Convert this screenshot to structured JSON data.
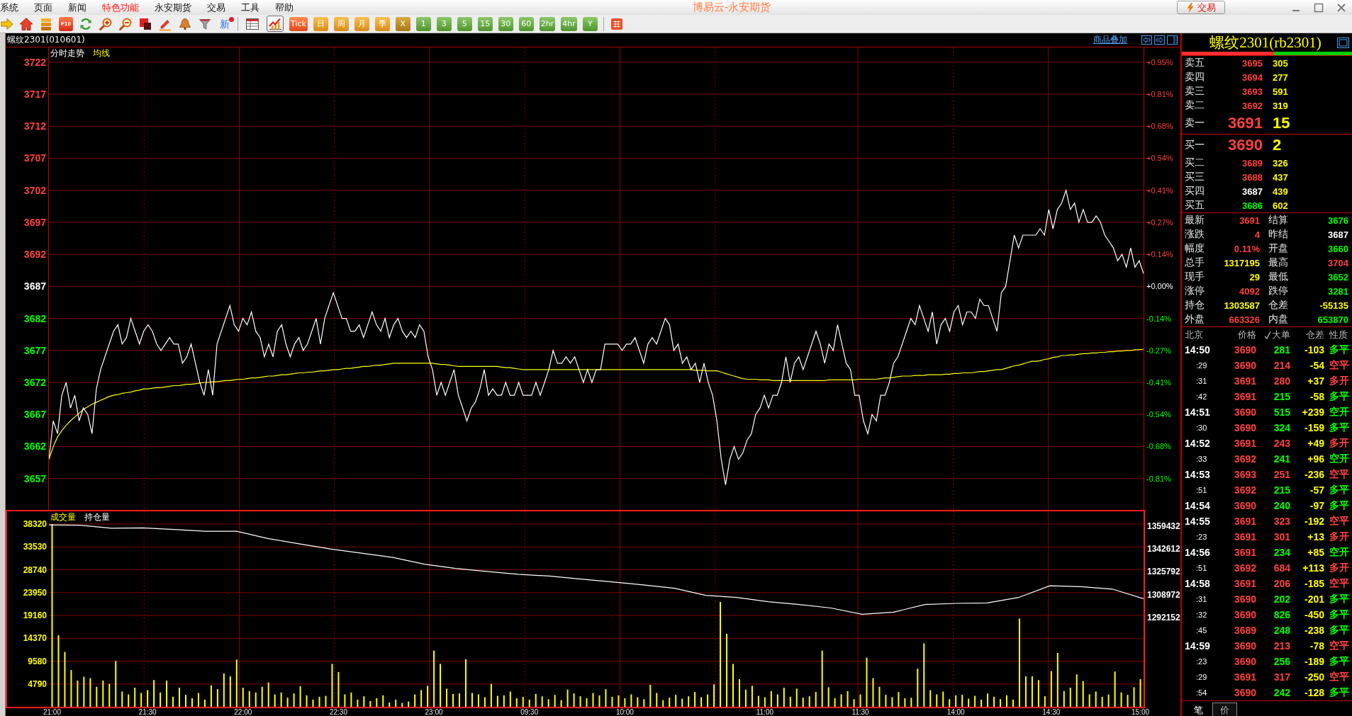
{
  "menu_bar": {
    "items": [
      {
        "label": "系统",
        "highlighted": false
      },
      {
        "label": "页面",
        "highlighted": false
      },
      {
        "label": "新闻",
        "highlighted": false
      },
      {
        "label": "特色功能",
        "highlighted": true
      },
      {
        "label": "永安期货",
        "highlighted": false
      },
      {
        "label": "交易",
        "highlighted": false
      },
      {
        "label": "工具",
        "highlighted": false
      },
      {
        "label": "帮助",
        "highlighted": false
      }
    ],
    "title": "博易云-永安期货",
    "trade_button": "交易"
  },
  "toolbar": {
    "f10_label": "F10",
    "news_label": "新",
    "news_unread": true,
    "view_buttons": [
      {
        "selected": false
      },
      {
        "selected": true
      }
    ],
    "periods": [
      {
        "label": "Tick",
        "kind": "tick"
      },
      {
        "label": "日",
        "kind": "orange"
      },
      {
        "label": "周",
        "kind": "orange"
      },
      {
        "label": "月",
        "kind": "orange"
      },
      {
        "label": "季",
        "kind": "orange"
      },
      {
        "label": "X",
        "kind": "gold"
      },
      {
        "label": "1",
        "kind": "green"
      },
      {
        "label": "3",
        "kind": "green"
      },
      {
        "label": "5",
        "kind": "green"
      },
      {
        "label": "15",
        "kind": "green"
      },
      {
        "label": "30",
        "kind": "green"
      },
      {
        "label": "60",
        "kind": "green"
      },
      {
        "label": "2hr",
        "kind": "green"
      },
      {
        "label": "4hr",
        "kind": "green"
      },
      {
        "label": "Y",
        "kind": "green"
      }
    ]
  },
  "chart_header": {
    "symbol": "螺纹2301(010601)",
    "overlay_link": "商品叠加"
  },
  "price_panel": {
    "percent_axis": [
      {
        "label": "+0.95%",
        "kind": "up"
      },
      {
        "label": "+0.81%",
        "kind": "up"
      },
      {
        "label": "+0.68%",
        "kind": "up"
      },
      {
        "label": "+0.54%",
        "kind": "up"
      },
      {
        "label": "+0.41%",
        "kind": "up"
      },
      {
        "label": "+0.27%",
        "kind": "up"
      },
      {
        "label": "+0.14%",
        "kind": "up"
      },
      {
        "label": "+0.00%",
        "kind": "flat"
      },
      {
        "label": "-0.14%",
        "kind": "down"
      },
      {
        "label": "-0.27%",
        "kind": "down"
      },
      {
        "label": "-0.41%",
        "kind": "down"
      },
      {
        "label": "-0.54%",
        "kind": "down"
      },
      {
        "label": "-0.68%",
        "kind": "down"
      },
      {
        "label": "-0.81%",
        "kind": "down"
      }
    ],
    "chart_data": {
      "type": "line",
      "grid": true,
      "ylim": [
        3652.1,
        3724.3
      ],
      "yticks": [
        3722,
        3717,
        3712,
        3707,
        3702,
        3697,
        3692,
        3687,
        3682,
        3677,
        3672,
        3667,
        3662,
        3657
      ],
      "series": [
        {
          "name": "分时走势",
          "color": "#ffffff",
          "values": [
            3660,
            3666,
            3664,
            3670,
            3672,
            3668,
            3670,
            3666,
            3668,
            3667,
            3664,
            3671,
            3674,
            3676,
            3678,
            3680,
            3681,
            3678,
            3679,
            3682,
            3680,
            3678,
            3680,
            3681,
            3680,
            3678,
            3677,
            3678,
            3679,
            3678,
            3678,
            3675,
            3676,
            3678,
            3675,
            3672,
            3670,
            3674,
            3670,
            3678,
            3680,
            3682,
            3684,
            3681,
            3680,
            3682,
            3681,
            3683,
            3680,
            3679,
            3676,
            3678,
            3676,
            3680,
            3681,
            3678,
            3676,
            3678,
            3679,
            3677,
            3678,
            3680,
            3682,
            3678,
            3682,
            3684,
            3686,
            3684,
            3682,
            3682,
            3680,
            3680,
            3681,
            3679,
            3681,
            3683,
            3681,
            3680,
            3682,
            3679,
            3681,
            3682,
            3680,
            3679,
            3680,
            3679,
            3681,
            3680,
            3676,
            3674,
            3670,
            3672,
            3670,
            3672,
            3674,
            3670,
            3668,
            3666,
            3668,
            3669,
            3671,
            3674,
            3670,
            3671,
            3670,
            3670,
            3672,
            3670,
            3670,
            3672,
            3670,
            3670,
            3670,
            3672,
            3670,
            3672,
            3674,
            3677,
            3675,
            3675,
            3676,
            3675,
            3676,
            3674,
            3672,
            3674,
            3672,
            3674,
            3674,
            3678,
            3678,
            3678,
            3678,
            3677,
            3678,
            3678,
            3679,
            3677,
            3675,
            3678,
            3679,
            3678,
            3680,
            3682,
            3681,
            3677,
            3678,
            3675,
            3676,
            3674,
            3675,
            3672,
            3675,
            3672,
            3670,
            3666,
            3660,
            3656,
            3660,
            3662,
            3660,
            3661,
            3663,
            3664,
            3667,
            3668,
            3670,
            3668,
            3670,
            3670,
            3672,
            3676,
            3672,
            3675,
            3676,
            3674,
            3676,
            3678,
            3680,
            3678,
            3675,
            3678,
            3677,
            3681,
            3678,
            3675,
            3674,
            3670,
            3670,
            3666,
            3664,
            3667,
            3666,
            3670,
            3670,
            3672,
            3675,
            3676,
            3678,
            3680,
            3682,
            3681,
            3684,
            3682,
            3680,
            3683,
            3678,
            3681,
            3682,
            3680,
            3683,
            3684,
            3681,
            3683,
            3683,
            3682,
            3685,
            3684,
            3684,
            3682,
            3680,
            3686,
            3687,
            3691,
            3695,
            3693,
            3695,
            3695,
            3695,
            3695,
            3696,
            3695,
            3699,
            3696,
            3699,
            3700,
            3702,
            3699,
            3700,
            3697,
            3699,
            3697,
            3697,
            3698,
            3697,
            3695,
            3694,
            3693,
            3691,
            3692,
            3690,
            3693,
            3690,
            3691,
            3689
          ]
        },
        {
          "name": "均线",
          "color": "#ffff00",
          "values": [
            3660,
            3662,
            3663.5,
            3664.5,
            3665.3,
            3666,
            3666.6,
            3667.2,
            3667.8,
            3668.2,
            3668.6,
            3668.9,
            3669.2,
            3669.5,
            3669.8,
            3670,
            3670.1,
            3670.3,
            3670.4,
            3670.5,
            3670.7,
            3670.8,
            3671,
            3671,
            3671.1,
            3671.2,
            3671.2,
            3671.3,
            3671.4,
            3671.5,
            3671.5,
            3671.6,
            3671.7,
            3671.7,
            3671.8,
            3671.9,
            3672,
            3672,
            3672.1,
            3672.1,
            3672.2,
            3672.3,
            3672.3,
            3672.4,
            3672.5,
            3672.5,
            3672.6,
            3672.7,
            3672.7,
            3672.8,
            3672.9,
            3673,
            3673,
            3673.1,
            3673.2,
            3673.2,
            3673.3,
            3673.4,
            3673.5,
            3673.5,
            3673.6,
            3673.6,
            3673.7,
            3673.8,
            3673.8,
            3673.9,
            3674,
            3674,
            3674.1,
            3674.2,
            3674.2,
            3674.3,
            3674.4,
            3674.5,
            3674.5,
            3674.6,
            3674.7,
            3674.7,
            3674.8,
            3674.9,
            3675,
            3675,
            3675,
            3675,
            3675,
            3675,
            3675,
            3675,
            3675,
            3675,
            3674.9,
            3674.8,
            3674.8,
            3674.7,
            3674.6,
            3674.5,
            3674.5,
            3674.5,
            3674.5,
            3674.5,
            3674.5,
            3674.5,
            3674.5,
            3674.5,
            3674.5,
            3674.4,
            3674.3,
            3674.3,
            3674.2,
            3674.1,
            3674,
            3674,
            3674,
            3674,
            3674,
            3674,
            3674,
            3674,
            3674,
            3674,
            3674,
            3674,
            3674,
            3674,
            3674,
            3674,
            3674,
            3674,
            3674,
            3674,
            3674,
            3674,
            3674,
            3674,
            3674,
            3674,
            3674,
            3674,
            3674,
            3674,
            3674,
            3674,
            3674,
            3674,
            3674,
            3674,
            3674,
            3674,
            3674,
            3674,
            3673.9,
            3673.9,
            3673.9,
            3673.8,
            3673.8,
            3673.8,
            3673.6,
            3673.4,
            3673.2,
            3673,
            3672.8,
            3672.6,
            3672.5,
            3672.5,
            3672.5,
            3672.4,
            3672.4,
            3672.4,
            3672.3,
            3672.3,
            3672.3,
            3672.3,
            3672.3,
            3672.3,
            3672.3,
            3672.3,
            3672.3,
            3672.3,
            3672.3,
            3672.3,
            3672.3,
            3672.4,
            3672.4,
            3672.4,
            3672.4,
            3672.4,
            3672.4,
            3672.4,
            3672.5,
            3672.5,
            3672.5,
            3672.5,
            3672.5,
            3672.6,
            3672.7,
            3672.7,
            3672.8,
            3672.9,
            3673,
            3673,
            3673,
            3673.1,
            3673.1,
            3673.1,
            3673.2,
            3673.2,
            3673.2,
            3673.2,
            3673.3,
            3673.3,
            3673.4,
            3673.4,
            3673.5,
            3673.5,
            3673.5,
            3673.6,
            3673.7,
            3673.7,
            3673.8,
            3673.9,
            3674,
            3674,
            3674.2,
            3674.4,
            3674.6,
            3674.7,
            3674.9,
            3675.1,
            3675.3,
            3675.3,
            3675.4,
            3675.6,
            3675.7,
            3675.9,
            3676,
            3676.2,
            3676.2,
            3676.3,
            3676.3,
            3676.4,
            3676.5,
            3676.5,
            3676.6,
            3676.6,
            3676.7,
            3676.7,
            3676.8,
            3676.8,
            3676.9,
            3676.9,
            3677,
            3677,
            3677.1,
            3677.1,
            3677.2
          ]
        }
      ]
    }
  },
  "volume_panel": {
    "chart_data": {
      "type": "bar",
      "grid": true,
      "ylim": [
        0,
        41000
      ],
      "yticks": [
        38320,
        33530,
        28740,
        23950,
        19160,
        14370,
        9580,
        4790
      ],
      "categories": [
        "21:00",
        null,
        null,
        null,
        null,
        null,
        null,
        null,
        null,
        null,
        null,
        null,
        null,
        null,
        null,
        "21:30",
        null,
        null,
        null,
        null,
        null,
        null,
        null,
        null,
        null,
        null,
        null,
        null,
        null,
        null,
        "22:00",
        null,
        null,
        null,
        null,
        null,
        null,
        null,
        null,
        null,
        null,
        null,
        null,
        null,
        null,
        "22:30",
        null,
        null,
        null,
        null,
        null,
        null,
        null,
        null,
        null,
        null,
        null,
        null,
        null,
        null,
        "23:00",
        null,
        null,
        null,
        null,
        null,
        null,
        null,
        null,
        null,
        null,
        null,
        null,
        null,
        null,
        "09:30",
        null,
        null,
        null,
        null,
        null,
        null,
        null,
        null,
        null,
        null,
        null,
        null,
        null,
        null,
        "10:00",
        null,
        null,
        null,
        null,
        null,
        null,
        null,
        null,
        null,
        null,
        null,
        null,
        null,
        null,
        null,
        null,
        null,
        null,
        null,
        null,
        null,
        "11:00",
        null,
        null,
        null,
        null,
        null,
        null,
        null,
        null,
        null,
        null,
        null,
        null,
        null,
        null,
        "11:30",
        null,
        null,
        null,
        null,
        null,
        null,
        null,
        null,
        null,
        null,
        null,
        null,
        null,
        null,
        "14:00",
        null,
        null,
        null,
        null,
        null,
        null,
        null,
        null,
        null,
        null,
        null,
        null,
        null,
        null,
        "14:30",
        null,
        null,
        null,
        null,
        null,
        null,
        null,
        null,
        null,
        null,
        null,
        null,
        null,
        "15:00"
      ],
      "series": [
        {
          "name": "成交量",
          "color": "#ffff00",
          "values": [
            38300,
            15000,
            11500,
            7700,
            5500,
            6300,
            6000,
            4200,
            5500,
            4800,
            9600,
            3200,
            2600,
            4000,
            2900,
            3500,
            5600,
            3000,
            5500,
            2100,
            4000,
            2500,
            1800,
            2900,
            1500,
            4500,
            3700,
            7000,
            6400,
            9900,
            4000,
            3300,
            3000,
            4200,
            5100,
            2600,
            3000,
            1900,
            2800,
            4300,
            2400,
            1500,
            2100,
            2300,
            9000,
            7300,
            2600,
            3000,
            1500,
            2200,
            1200,
            1800,
            2400,
            900,
            1500,
            800,
            1100,
            2600,
            3500,
            4400,
            11800,
            9000,
            3800,
            2700,
            2800,
            10000,
            2900,
            2600,
            2000,
            4800,
            2300,
            2400,
            3200,
            1800,
            2100,
            1500,
            2700,
            2200,
            1600,
            2500,
            1400,
            3600,
            2800,
            2200,
            1800,
            2900,
            2400,
            3700,
            2100,
            2400,
            1800,
            2600,
            2000,
            1600,
            4600,
            2900,
            1400,
            1900,
            2500,
            1700,
            2200,
            3100,
            2000,
            2600,
            4700,
            22000,
            15300,
            9000,
            5800,
            3600,
            4400,
            2300,
            2000,
            3300,
            2600,
            4000,
            2100,
            3800,
            1900,
            2200,
            3100,
            11800,
            4100,
            1800,
            2600,
            3300,
            1600,
            2600,
            10300,
            6000,
            4200,
            2500,
            2000,
            3100,
            1800,
            1900,
            8000,
            13300,
            3500,
            2600,
            3200,
            1600,
            2400,
            2500,
            1700,
            2300,
            1500,
            2800,
            2100,
            1600,
            2400,
            1500,
            18500,
            6400,
            6400,
            5600,
            2200,
            7500,
            11300,
            3300,
            4000,
            6800,
            5400,
            2600,
            3200,
            2100,
            2600,
            7400,
            3000,
            2500,
            4100,
            5800
          ]
        }
      ]
    },
    "open_interest": {
      "chart_data": {
        "type": "line",
        "ylim": [
          1224872,
          1368750
        ],
        "yticks": [
          1359432,
          1342612,
          1325792,
          1308972,
          1292152
        ],
        "series": [
          {
            "name": "持仓量",
            "color": "#ffffff",
            "values": [
              1358800,
              1358500,
              1356300,
              1356600,
              1355400,
              1354100,
              1354100,
              1348800,
              1344800,
              1341000,
              1337900,
              1334800,
              1329800,
              1326700,
              1324500,
              1322400,
              1321100,
              1318900,
              1316800,
              1314600,
              1312100,
              1306900,
              1305300,
              1302200,
              1300100,
              1297600,
              1293000,
              1294500,
              1300100,
              1301000,
              1301300,
              1305300,
              1313900,
              1313300,
              1311500,
              1304400
            ]
          }
        ]
      }
    }
  },
  "quote_panel": {
    "title": "螺纹2301(rb2301)",
    "ratio_bar": {
      "level": 0.54
    },
    "asks": [
      {
        "label": "卖五",
        "price": "3695",
        "volume": "305",
        "color": "#ff4040",
        "kind": "level"
      },
      {
        "label": "卖四",
        "price": "3694",
        "volume": "277",
        "color": "#ff4040",
        "kind": "level"
      },
      {
        "label": "卖三",
        "price": "3693",
        "volume": "591",
        "color": "#ff4040",
        "kind": "level"
      },
      {
        "label": "卖二",
        "price": "3692",
        "volume": "319",
        "color": "#ff4040",
        "kind": "level"
      },
      {
        "label": "卖一",
        "price": "3691",
        "volume": "15",
        "color": "#ff4040",
        "kind": "best"
      }
    ],
    "bids": [
      {
        "label": "买一",
        "price": "3690",
        "volume": "2",
        "color": "#ff4040",
        "kind": "best"
      },
      {
        "label": "买二",
        "price": "3689",
        "volume": "326",
        "color": "#ff4040",
        "kind": "level"
      },
      {
        "label": "买三",
        "price": "3688",
        "volume": "437",
        "color": "#ff4040",
        "kind": "level"
      },
      {
        "label": "买四",
        "price": "3687",
        "volume": "439",
        "color": "#ffffff",
        "kind": "level"
      },
      {
        "label": "买五",
        "price": "3686",
        "volume": "602",
        "color": "#00ff00",
        "kind": "level"
      }
    ],
    "stats": [
      {
        "label": "最新",
        "value": "3691",
        "color": "#ff4040"
      },
      {
        "label": "结算",
        "value": "3676",
        "color": "#00ff00"
      },
      {
        "label": "涨跌",
        "value": "4",
        "color": "#ff4040"
      },
      {
        "label": "昨结",
        "value": "3687",
        "color": "#ffffff"
      },
      {
        "label": "幅度",
        "value": "0.11%",
        "color": "#ff4040"
      },
      {
        "label": "开盘",
        "value": "3660",
        "color": "#00ff00"
      },
      {
        "label": "总手",
        "value": "1317195",
        "color": "#ffff00"
      },
      {
        "label": "最高",
        "value": "3704",
        "color": "#ff4040"
      },
      {
        "label": "现手",
        "value": "29",
        "color": "#ffff00"
      },
      {
        "label": "最低",
        "value": "3652",
        "color": "#00ff00"
      },
      {
        "label": "涨停",
        "value": "4092",
        "color": "#ff4040"
      },
      {
        "label": "跌停",
        "value": "3281",
        "color": "#00ff00"
      },
      {
        "label": "持仓",
        "value": "1303587",
        "color": "#ffff00"
      },
      {
        "label": "仓差",
        "value": "-55135",
        "color": "#ffff00"
      },
      {
        "label": "外盘",
        "value": "663326",
        "color": "#ff4040"
      },
      {
        "label": "内盘",
        "value": "653870",
        "color": "#00ff00"
      }
    ],
    "trade_columns": [
      {
        "label": "北京",
        "kind": "text"
      },
      {
        "label": "价格",
        "kind": "text"
      },
      {
        "label": "大单",
        "kind": "toggle",
        "checked": true
      },
      {
        "label": "仓差",
        "kind": "text"
      },
      {
        "label": "性质",
        "kind": "text"
      }
    ],
    "trades": [
      {
        "time": "14:50",
        "kind": "minute",
        "price": "3690",
        "volume": {
          "value": "281",
          "color": "#00ff00"
        },
        "oi_change": "-103",
        "nature": {
          "label": "多平",
          "color": "#00ff00"
        }
      },
      {
        "time": ":29",
        "kind": "second",
        "price": "3690",
        "volume": {
          "value": "214",
          "color": "#ff4040"
        },
        "oi_change": "-54",
        "nature": {
          "label": "空平",
          "color": "#ff4040"
        }
      },
      {
        "time": ":31",
        "kind": "second",
        "price": "3691",
        "volume": {
          "value": "280",
          "color": "#ff4040"
        },
        "oi_change": "+37",
        "nature": {
          "label": "多开",
          "color": "#ff4040"
        }
      },
      {
        "time": ":42",
        "kind": "second",
        "price": "3691",
        "volume": {
          "value": "215",
          "color": "#00ff00"
        },
        "oi_change": "-58",
        "nature": {
          "label": "多平",
          "color": "#00ff00"
        }
      },
      {
        "time": "14:51",
        "kind": "minute",
        "price": "3690",
        "volume": {
          "value": "515",
          "color": "#00ff00"
        },
        "oi_change": "+239",
        "nature": {
          "label": "空开",
          "color": "#00ff00"
        }
      },
      {
        "time": ":30",
        "kind": "second",
        "price": "3690",
        "volume": {
          "value": "324",
          "color": "#00ff00"
        },
        "oi_change": "-159",
        "nature": {
          "label": "多平",
          "color": "#00ff00"
        }
      },
      {
        "time": "14:52",
        "kind": "minute",
        "price": "3691",
        "volume": {
          "value": "243",
          "color": "#ff4040"
        },
        "oi_change": "+49",
        "nature": {
          "label": "多开",
          "color": "#ff4040"
        }
      },
      {
        "time": ":33",
        "kind": "second",
        "price": "3692",
        "volume": {
          "value": "241",
          "color": "#00ff00"
        },
        "oi_change": "+96",
        "nature": {
          "label": "空开",
          "color": "#00ff00"
        }
      },
      {
        "time": "14:53",
        "kind": "minute",
        "price": "3693",
        "volume": {
          "value": "251",
          "color": "#ff4040"
        },
        "oi_change": "-236",
        "nature": {
          "label": "空平",
          "color": "#ff4040"
        }
      },
      {
        "time": ":51",
        "kind": "second",
        "price": "3692",
        "volume": {
          "value": "215",
          "color": "#00ff00"
        },
        "oi_change": "-57",
        "nature": {
          "label": "多平",
          "color": "#00ff00"
        }
      },
      {
        "time": "14:54",
        "kind": "minute",
        "price": "3690",
        "volume": {
          "value": "240",
          "color": "#00ff00"
        },
        "oi_change": "-97",
        "nature": {
          "label": "多平",
          "color": "#00ff00"
        }
      },
      {
        "time": "14:55",
        "kind": "minute",
        "price": "3691",
        "volume": {
          "value": "323",
          "color": "#ff4040"
        },
        "oi_change": "-192",
        "nature": {
          "label": "空平",
          "color": "#ff4040"
        }
      },
      {
        "time": ":23",
        "kind": "second",
        "price": "3691",
        "volume": {
          "value": "301",
          "color": "#ff4040"
        },
        "oi_change": "+13",
        "nature": {
          "label": "多开",
          "color": "#ff4040"
        }
      },
      {
        "time": "14:56",
        "kind": "minute",
        "price": "3691",
        "volume": {
          "value": "234",
          "color": "#00ff00"
        },
        "oi_change": "+85",
        "nature": {
          "label": "空开",
          "color": "#00ff00"
        }
      },
      {
        "time": ":51",
        "kind": "second",
        "price": "3692",
        "volume": {
          "value": "684",
          "color": "#ff4040"
        },
        "oi_change": "+113",
        "nature": {
          "label": "多开",
          "color": "#ff4040"
        }
      },
      {
        "time": "14:58",
        "kind": "minute",
        "price": "3691",
        "volume": {
          "value": "206",
          "color": "#ff4040"
        },
        "oi_change": "-185",
        "nature": {
          "label": "空平",
          "color": "#ff4040"
        }
      },
      {
        "time": ":31",
        "kind": "second",
        "price": "3690",
        "volume": {
          "value": "202",
          "color": "#00ff00"
        },
        "oi_change": "-201",
        "nature": {
          "label": "多平",
          "color": "#00ff00"
        }
      },
      {
        "time": ":32",
        "kind": "second",
        "price": "3690",
        "volume": {
          "value": "826",
          "color": "#00ff00"
        },
        "oi_change": "-450",
        "nature": {
          "label": "多平",
          "color": "#00ff00"
        }
      },
      {
        "time": ":45",
        "kind": "second",
        "price": "3689",
        "volume": {
          "value": "248",
          "color": "#00ff00"
        },
        "oi_change": "-238",
        "nature": {
          "label": "多平",
          "color": "#00ff00"
        }
      },
      {
        "time": "14:59",
        "kind": "minute",
        "price": "3690",
        "volume": {
          "value": "213",
          "color": "#ff4040"
        },
        "oi_change": "-78",
        "nature": {
          "label": "空平",
          "color": "#ff4040"
        }
      },
      {
        "time": ":23",
        "kind": "second",
        "price": "3690",
        "volume": {
          "value": "256",
          "color": "#00ff00"
        },
        "oi_change": "-189",
        "nature": {
          "label": "多平",
          "color": "#00ff00"
        }
      },
      {
        "time": ":29",
        "kind": "second",
        "price": "3691",
        "volume": {
          "value": "317",
          "color": "#ff4040"
        },
        "oi_change": "-250",
        "nature": {
          "label": "空平",
          "color": "#ff4040"
        }
      },
      {
        "time": ":54",
        "kind": "second",
        "price": "3690",
        "volume": {
          "value": "242",
          "color": "#00ff00"
        },
        "oi_change": "-128",
        "nature": {
          "label": "多平",
          "color": "#00ff00"
        }
      }
    ],
    "tabs": [
      {
        "label": "笔",
        "selected": true
      },
      {
        "label": "价",
        "selected": false
      }
    ]
  }
}
